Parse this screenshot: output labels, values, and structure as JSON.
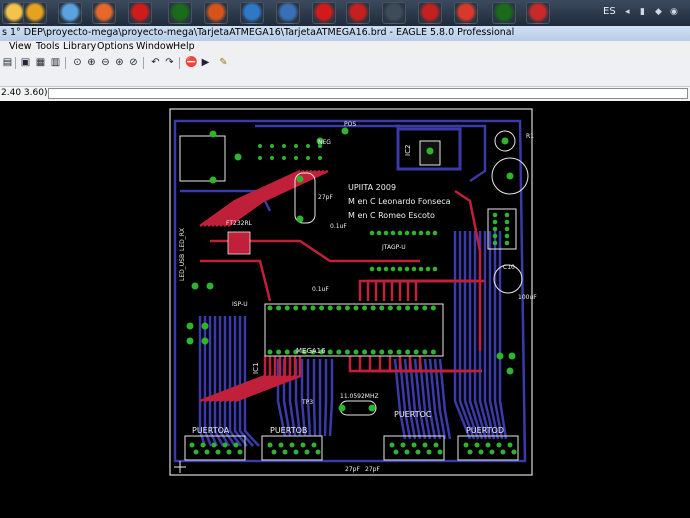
{
  "taskbar": {
    "language": "ES",
    "apps": [
      {
        "icon": "windows-explorer-icon",
        "color": "#f3c34a"
      },
      {
        "icon": "media-player-icon",
        "color": "#e6a21e"
      },
      {
        "icon": "network-icon",
        "color": "#5ba3e0"
      },
      {
        "icon": "firefox-icon",
        "color": "#e5682a"
      },
      {
        "icon": "opera-icon",
        "color": "#d11b1b"
      },
      {
        "icon": "torrent-icon",
        "color": "#1a6c1a"
      },
      {
        "icon": "matlab-icon",
        "color": "#d5541c"
      },
      {
        "icon": "app-blue-icon",
        "color": "#2d79c7"
      },
      {
        "icon": "monitor-icon",
        "color": "#3b6fb5"
      },
      {
        "icon": "solidworks-icon",
        "color": "#d21a1a"
      },
      {
        "icon": "app-red-icon",
        "color": "#c61f1f"
      },
      {
        "icon": "steam-icon",
        "color": "#3e4b59"
      },
      {
        "icon": "microchip-icon",
        "color": "#c42020"
      },
      {
        "icon": "wifi-icon",
        "color": "#d83a2a"
      },
      {
        "icon": "torrent-2-icon",
        "color": "#1a6c1a"
      },
      {
        "icon": "eagle-icon",
        "color": "#c92929"
      }
    ]
  },
  "window": {
    "title": "s 1° DEP\\proyecto-mega\\proyecto-mega\\TarjetaATMEGA16\\TarjetaATMEGA16.brd - EAGLE 5.8.0 Professional"
  },
  "menu": [
    "View",
    "Tools",
    "Library",
    "Options",
    "Window",
    "Help"
  ],
  "command": {
    "coordinates": "2.40 3.60)",
    "input_value": ""
  },
  "board": {
    "labels": {
      "university": "UPIITA 2009",
      "author1": "M en C Leonardo Fonseca",
      "author2": "M en C Romeo Escoto",
      "chip_main": "MEGA16",
      "ic1": "IC1",
      "ftdi": "FT232RL",
      "pos": "POS",
      "neg": "NEG",
      "ic2": "IC2",
      "puertoa": "PUERTOA",
      "puertob": "PUERTOB",
      "puertoc": "PUERTOC",
      "puertod": "PUERTOD",
      "crystal": "11.0592MHZ",
      "cap_27pf": "27pF",
      "cap_01uf": "0.1uF",
      "jtag": "JTAGP-U",
      "led_rx": "LED_RX",
      "led_usb": "LED_USB",
      "isp": "ISP-U",
      "cap_100uf": "100uF",
      "c10": "C10",
      "tp3": "TP3",
      "r1": "R1"
    },
    "colors": {
      "top_copper": "#c0203a",
      "bottom_copper": "#3a3aa8",
      "pads": "#2fb42f",
      "silkscreen": "#e8e8e8",
      "board_outline": "#d9d9d9",
      "background": "#000000"
    }
  }
}
